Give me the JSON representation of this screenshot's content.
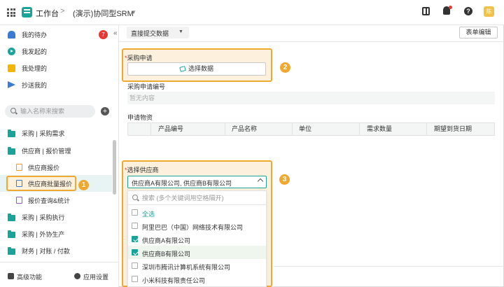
{
  "topbar": {
    "app_title": "工作台",
    "breadcrumb_sep": ">",
    "current_app": "(演示)协同型SRM",
    "avatar_text": "陈"
  },
  "sidebar": {
    "items": [
      {
        "label": "我的待办",
        "badge": "7",
        "icon": "bell-icon"
      },
      {
        "label": "我发起的",
        "icon": "play-circle-icon"
      },
      {
        "label": "我处理的",
        "icon": "checklist-icon"
      },
      {
        "label": "抄送我的",
        "icon": "send-icon"
      }
    ],
    "search_placeholder": "输入名称来搜索",
    "groups": [
      {
        "label": "采购 | 采购需求"
      },
      {
        "label": "供应商 | 报价管理"
      }
    ],
    "sub_items": [
      {
        "label": "供应商报价"
      },
      {
        "label": "供应商批量报价"
      },
      {
        "label": "报价查询&统计"
      }
    ],
    "groups_after": [
      {
        "label": "采购 | 采购执行"
      },
      {
        "label": "采购 | 外协生产"
      },
      {
        "label": "财务 | 对账 / 付款"
      }
    ],
    "bottom": {
      "advanced": "高级功能",
      "settings": "应用设置"
    },
    "collapse": "«"
  },
  "annotations": {
    "one": "1",
    "two": "2",
    "three": "3"
  },
  "toolbar": {
    "filter_label": "直接提交数据",
    "edit_form": "表单编辑"
  },
  "form": {
    "req_mark": "*",
    "purchase_request": {
      "label": "采购申请",
      "button": "选择数据"
    },
    "request_no": {
      "label": "采购申请编号",
      "value": "暂无内容"
    },
    "materials": {
      "label": "申请物资",
      "columns": [
        "",
        "产品编号",
        "产品名称",
        "单位",
        "需求数量",
        "期望到货日期"
      ]
    },
    "vendor": {
      "label": "选择供应商",
      "value": "供应商A有限公司, 供应商B有限公司",
      "search_placeholder": "搜索 (多个关键词用空格隔开)",
      "options": [
        {
          "label": "全选",
          "checked": false,
          "highlight": false
        },
        {
          "label": "阿里巴巴（中国）网络技术有限公司",
          "checked": false,
          "highlight": false
        },
        {
          "label": "供应商A有限公司",
          "checked": true,
          "highlight": false
        },
        {
          "label": "供应商B有限公司",
          "checked": true,
          "highlight": true
        },
        {
          "label": "深圳市腾讯计算机系统有限公司",
          "checked": false,
          "highlight": false
        },
        {
          "label": "小米科技有限责任公司",
          "checked": false,
          "highlight": false
        }
      ]
    }
  },
  "colors": {
    "accent": "#1aa39a",
    "highlight": "#f0a830",
    "badge": "#e53935"
  }
}
